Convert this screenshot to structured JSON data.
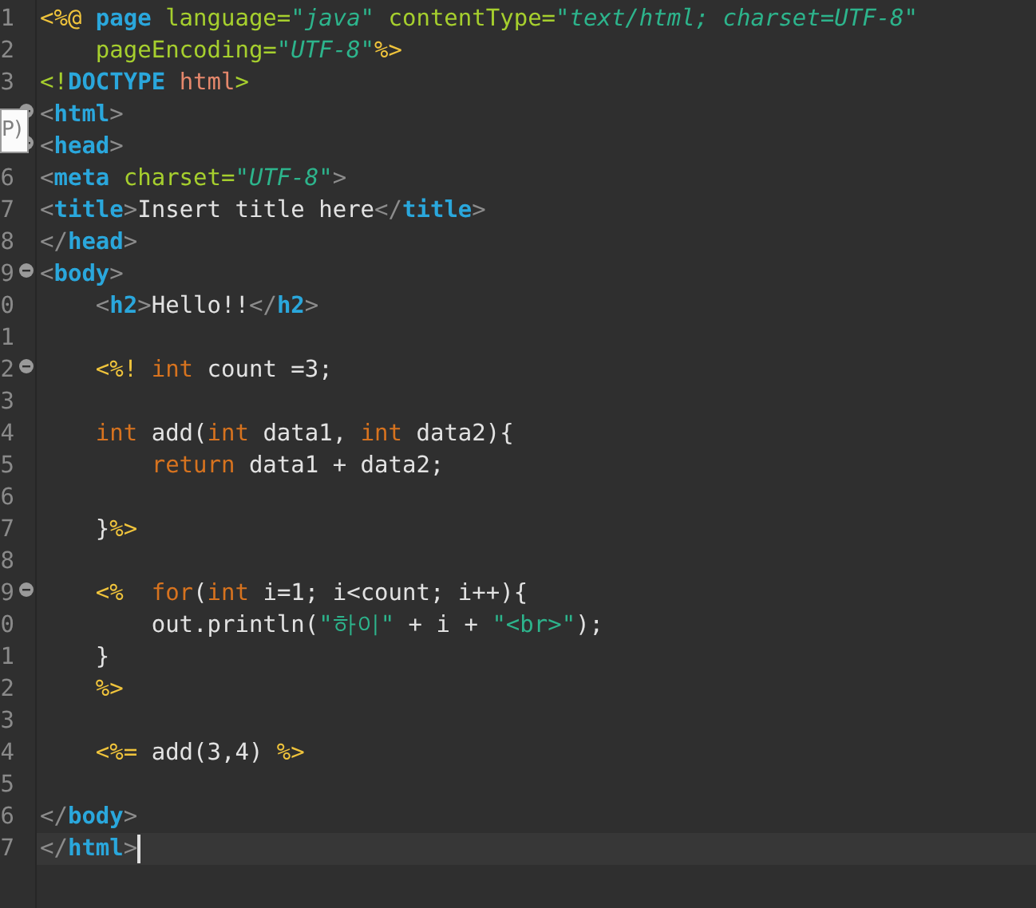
{
  "editor": {
    "tooltip": "P)",
    "lines": [
      {
        "num": "1",
        "fold": false,
        "current": false,
        "tokens": [
          {
            "kind": "jsp",
            "t": "<%@ "
          },
          {
            "kind": "tag",
            "t": "page "
          },
          {
            "kind": "attr",
            "t": "language="
          },
          {
            "kind": "str",
            "t": "\"java\" "
          },
          {
            "kind": "attr",
            "t": "contentType="
          },
          {
            "kind": "str",
            "t": "\"text/html; charset=UTF-8\""
          }
        ]
      },
      {
        "num": "2",
        "fold": false,
        "current": false,
        "tokens": [
          {
            "kind": "attr",
            "t": "    pageEncoding="
          },
          {
            "kind": "str",
            "t": "\"UTF-8\""
          },
          {
            "kind": "jsp",
            "t": "%>"
          }
        ]
      },
      {
        "num": "3",
        "fold": false,
        "current": false,
        "tokens": [
          {
            "kind": "dt",
            "t": "<!"
          },
          {
            "kind": "tag",
            "t": "DOCTYPE "
          },
          {
            "kind": "dtn",
            "t": "html"
          },
          {
            "kind": "dt",
            "t": ">"
          }
        ]
      },
      {
        "fold": true,
        "current": false,
        "tokens": [
          {
            "kind": "br",
            "t": "<"
          },
          {
            "kind": "tag",
            "t": "html"
          },
          {
            "kind": "br",
            "t": ">"
          }
        ]
      },
      {
        "fold": true,
        "current": false,
        "tokens": [
          {
            "kind": "br",
            "t": "<"
          },
          {
            "kind": "tag",
            "t": "head"
          },
          {
            "kind": "br",
            "t": ">"
          }
        ]
      },
      {
        "num": "6",
        "fold": false,
        "current": false,
        "tokens": [
          {
            "kind": "br",
            "t": "<"
          },
          {
            "kind": "tag",
            "t": "meta "
          },
          {
            "kind": "attr",
            "t": "charset="
          },
          {
            "kind": "str",
            "t": "\"UTF-8\""
          },
          {
            "kind": "br",
            "t": ">"
          }
        ]
      },
      {
        "num": "7",
        "fold": false,
        "current": false,
        "tokens": [
          {
            "kind": "br",
            "t": "<"
          },
          {
            "kind": "tag",
            "t": "title"
          },
          {
            "kind": "br",
            "t": ">"
          },
          {
            "kind": "text",
            "t": "Insert title here"
          },
          {
            "kind": "br",
            "t": "</"
          },
          {
            "kind": "tag",
            "t": "title"
          },
          {
            "kind": "br",
            "t": ">"
          }
        ]
      },
      {
        "num": "8",
        "fold": false,
        "current": false,
        "tokens": [
          {
            "kind": "br",
            "t": "</"
          },
          {
            "kind": "tag",
            "t": "head"
          },
          {
            "kind": "br",
            "t": ">"
          }
        ]
      },
      {
        "num": "9",
        "fold": true,
        "current": false,
        "tokens": [
          {
            "kind": "br",
            "t": "<"
          },
          {
            "kind": "tag",
            "t": "body"
          },
          {
            "kind": "br",
            "t": ">"
          }
        ]
      },
      {
        "num": "0",
        "fold": false,
        "current": false,
        "tokens": [
          {
            "kind": "br",
            "t": "    <"
          },
          {
            "kind": "tag",
            "t": "h2"
          },
          {
            "kind": "br",
            "t": ">"
          },
          {
            "kind": "text",
            "t": "Hello!!"
          },
          {
            "kind": "br",
            "t": "</"
          },
          {
            "kind": "tag",
            "t": "h2"
          },
          {
            "kind": "br",
            "t": ">"
          }
        ]
      },
      {
        "num": "1",
        "fold": false,
        "current": false
      },
      {
        "num": "2",
        "fold": true,
        "current": false,
        "tokens": [
          {
            "kind": "jsp",
            "t": "    <%! "
          },
          {
            "kind": "kw",
            "t": "int"
          },
          {
            "kind": "text",
            "t": " count =3;"
          }
        ]
      },
      {
        "num": "3",
        "fold": false,
        "current": false
      },
      {
        "num": "4",
        "fold": false,
        "current": false,
        "tokens": [
          {
            "kind": "kw",
            "t": "    int"
          },
          {
            "kind": "text",
            "t": " add("
          },
          {
            "kind": "kw",
            "t": "int"
          },
          {
            "kind": "text",
            "t": " data1, "
          },
          {
            "kind": "kw",
            "t": "int"
          },
          {
            "kind": "text",
            "t": " data2){"
          }
        ]
      },
      {
        "num": "5",
        "fold": false,
        "current": false,
        "tokens": [
          {
            "kind": "kw",
            "t": "        return"
          },
          {
            "kind": "text",
            "t": " data1 + data2;"
          }
        ]
      },
      {
        "num": "6",
        "fold": false,
        "current": false
      },
      {
        "num": "7",
        "fold": false,
        "current": false,
        "tokens": [
          {
            "kind": "text",
            "t": "    }"
          },
          {
            "kind": "jsp",
            "t": "%>"
          }
        ]
      },
      {
        "num": "8",
        "fold": false,
        "current": false
      },
      {
        "num": "9",
        "fold": true,
        "current": false,
        "tokens": [
          {
            "kind": "jsp",
            "t": "    <%  "
          },
          {
            "kind": "kw",
            "t": "for"
          },
          {
            "kind": "text",
            "t": "("
          },
          {
            "kind": "kw",
            "t": "int"
          },
          {
            "kind": "text",
            "t": " i=1; i<count; i++){"
          }
        ]
      },
      {
        "num": "0",
        "fold": false,
        "current": false,
        "tokens": [
          {
            "kind": "text",
            "t": "        out.println("
          },
          {
            "kind": "js",
            "t": "\"하이\""
          },
          {
            "kind": "text",
            "t": " + i + "
          },
          {
            "kind": "js",
            "t": "\"<br>\""
          },
          {
            "kind": "text",
            "t": ");"
          }
        ]
      },
      {
        "num": "1",
        "fold": false,
        "current": false,
        "tokens": [
          {
            "kind": "text",
            "t": "    }"
          }
        ]
      },
      {
        "num": "2",
        "fold": false,
        "current": false,
        "tokens": [
          {
            "kind": "jsp",
            "t": "    %>"
          }
        ]
      },
      {
        "num": "3",
        "fold": false,
        "current": false
      },
      {
        "num": "4",
        "fold": false,
        "current": false,
        "tokens": [
          {
            "kind": "jsp",
            "t": "    <%="
          },
          {
            "kind": "text",
            "t": " add(3,4) "
          },
          {
            "kind": "jsp",
            "t": "%>"
          }
        ]
      },
      {
        "num": "5",
        "fold": false,
        "current": false
      },
      {
        "num": "6",
        "fold": false,
        "current": false,
        "tokens": [
          {
            "kind": "br",
            "t": "</"
          },
          {
            "kind": "tag",
            "t": "body"
          },
          {
            "kind": "br",
            "t": ">"
          }
        ]
      },
      {
        "num": "7",
        "fold": false,
        "current": true,
        "tokens": [
          {
            "kind": "br",
            "t": "</"
          },
          {
            "kind": "tag",
            "t": "html"
          },
          {
            "kind": "br",
            "t": ">"
          }
        ]
      }
    ]
  }
}
